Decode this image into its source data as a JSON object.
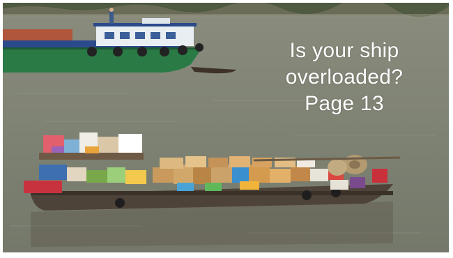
{
  "image": {
    "subject": "photo",
    "colors": {
      "water": "#7f8374",
      "far_shore": "#6b6c58",
      "barge_hull_green": "#2a7a46",
      "barge_cabin": "#e9eef2",
      "boat_hull": "#4e4339",
      "cargo_box": "#c99a5b",
      "caption_text": "#ffffff"
    }
  },
  "caption": {
    "line1": "Is your ship",
    "line2": "overloaded?",
    "line3": "Page 13"
  }
}
